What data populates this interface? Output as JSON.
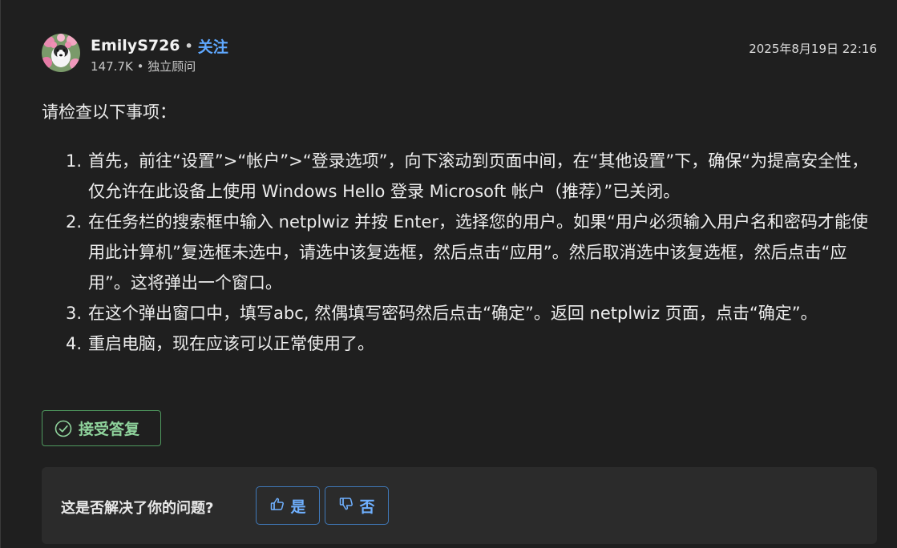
{
  "author": {
    "name": "EmilyS726",
    "separator": "•",
    "follow_label": "关注",
    "stats": "147.7K",
    "meta_separator": "•",
    "role": "独立顾问",
    "avatar_icon": "avatar-photo-dog-flowers"
  },
  "post": {
    "date": "2025年8月19日 22:16",
    "intro": "请检查以下事项：",
    "steps": [
      {
        "num": "1.",
        "text": "首先，前往“设置”>“帐户”>“登录选项”，向下滚动到页面中间，在“其他设置”下，确保“为提高安全性，仅允许在此设备上使用 Windows Hello 登录 Microsoft 帐户（推荐）”已关闭。"
      },
      {
        "num": "2.",
        "text": "在任务栏的搜索框中输入 netplwiz 并按 Enter，选择您的用户。如果“用户必须输入用户名和密码才能使用此计算机”复选框未选中，请选中该复选框，然后点击“应用”。然后取消选中该复选框，然后点击“应用”。这将弹出一个窗口。"
      },
      {
        "num": "3.",
        "text": "在这个弹出窗口中，填写abc, 然偶填写密码然后点击“确定”。返回 netplwiz 页面，点击“确定”。"
      },
      {
        "num": "4.",
        "text": "重启电脑，现在应该可以正常使用了。"
      }
    ]
  },
  "actions": {
    "accept_label": "接受答复",
    "accept_icon": "check-circle-icon",
    "accent_color": "#8fd39c"
  },
  "feedback": {
    "question": "这是否解决了你的问题?",
    "yes_label": "是",
    "no_label": "否",
    "yes_icon": "thumbs-up-icon",
    "no_icon": "thumbs-down-icon",
    "button_color": "#6fb0ff"
  }
}
